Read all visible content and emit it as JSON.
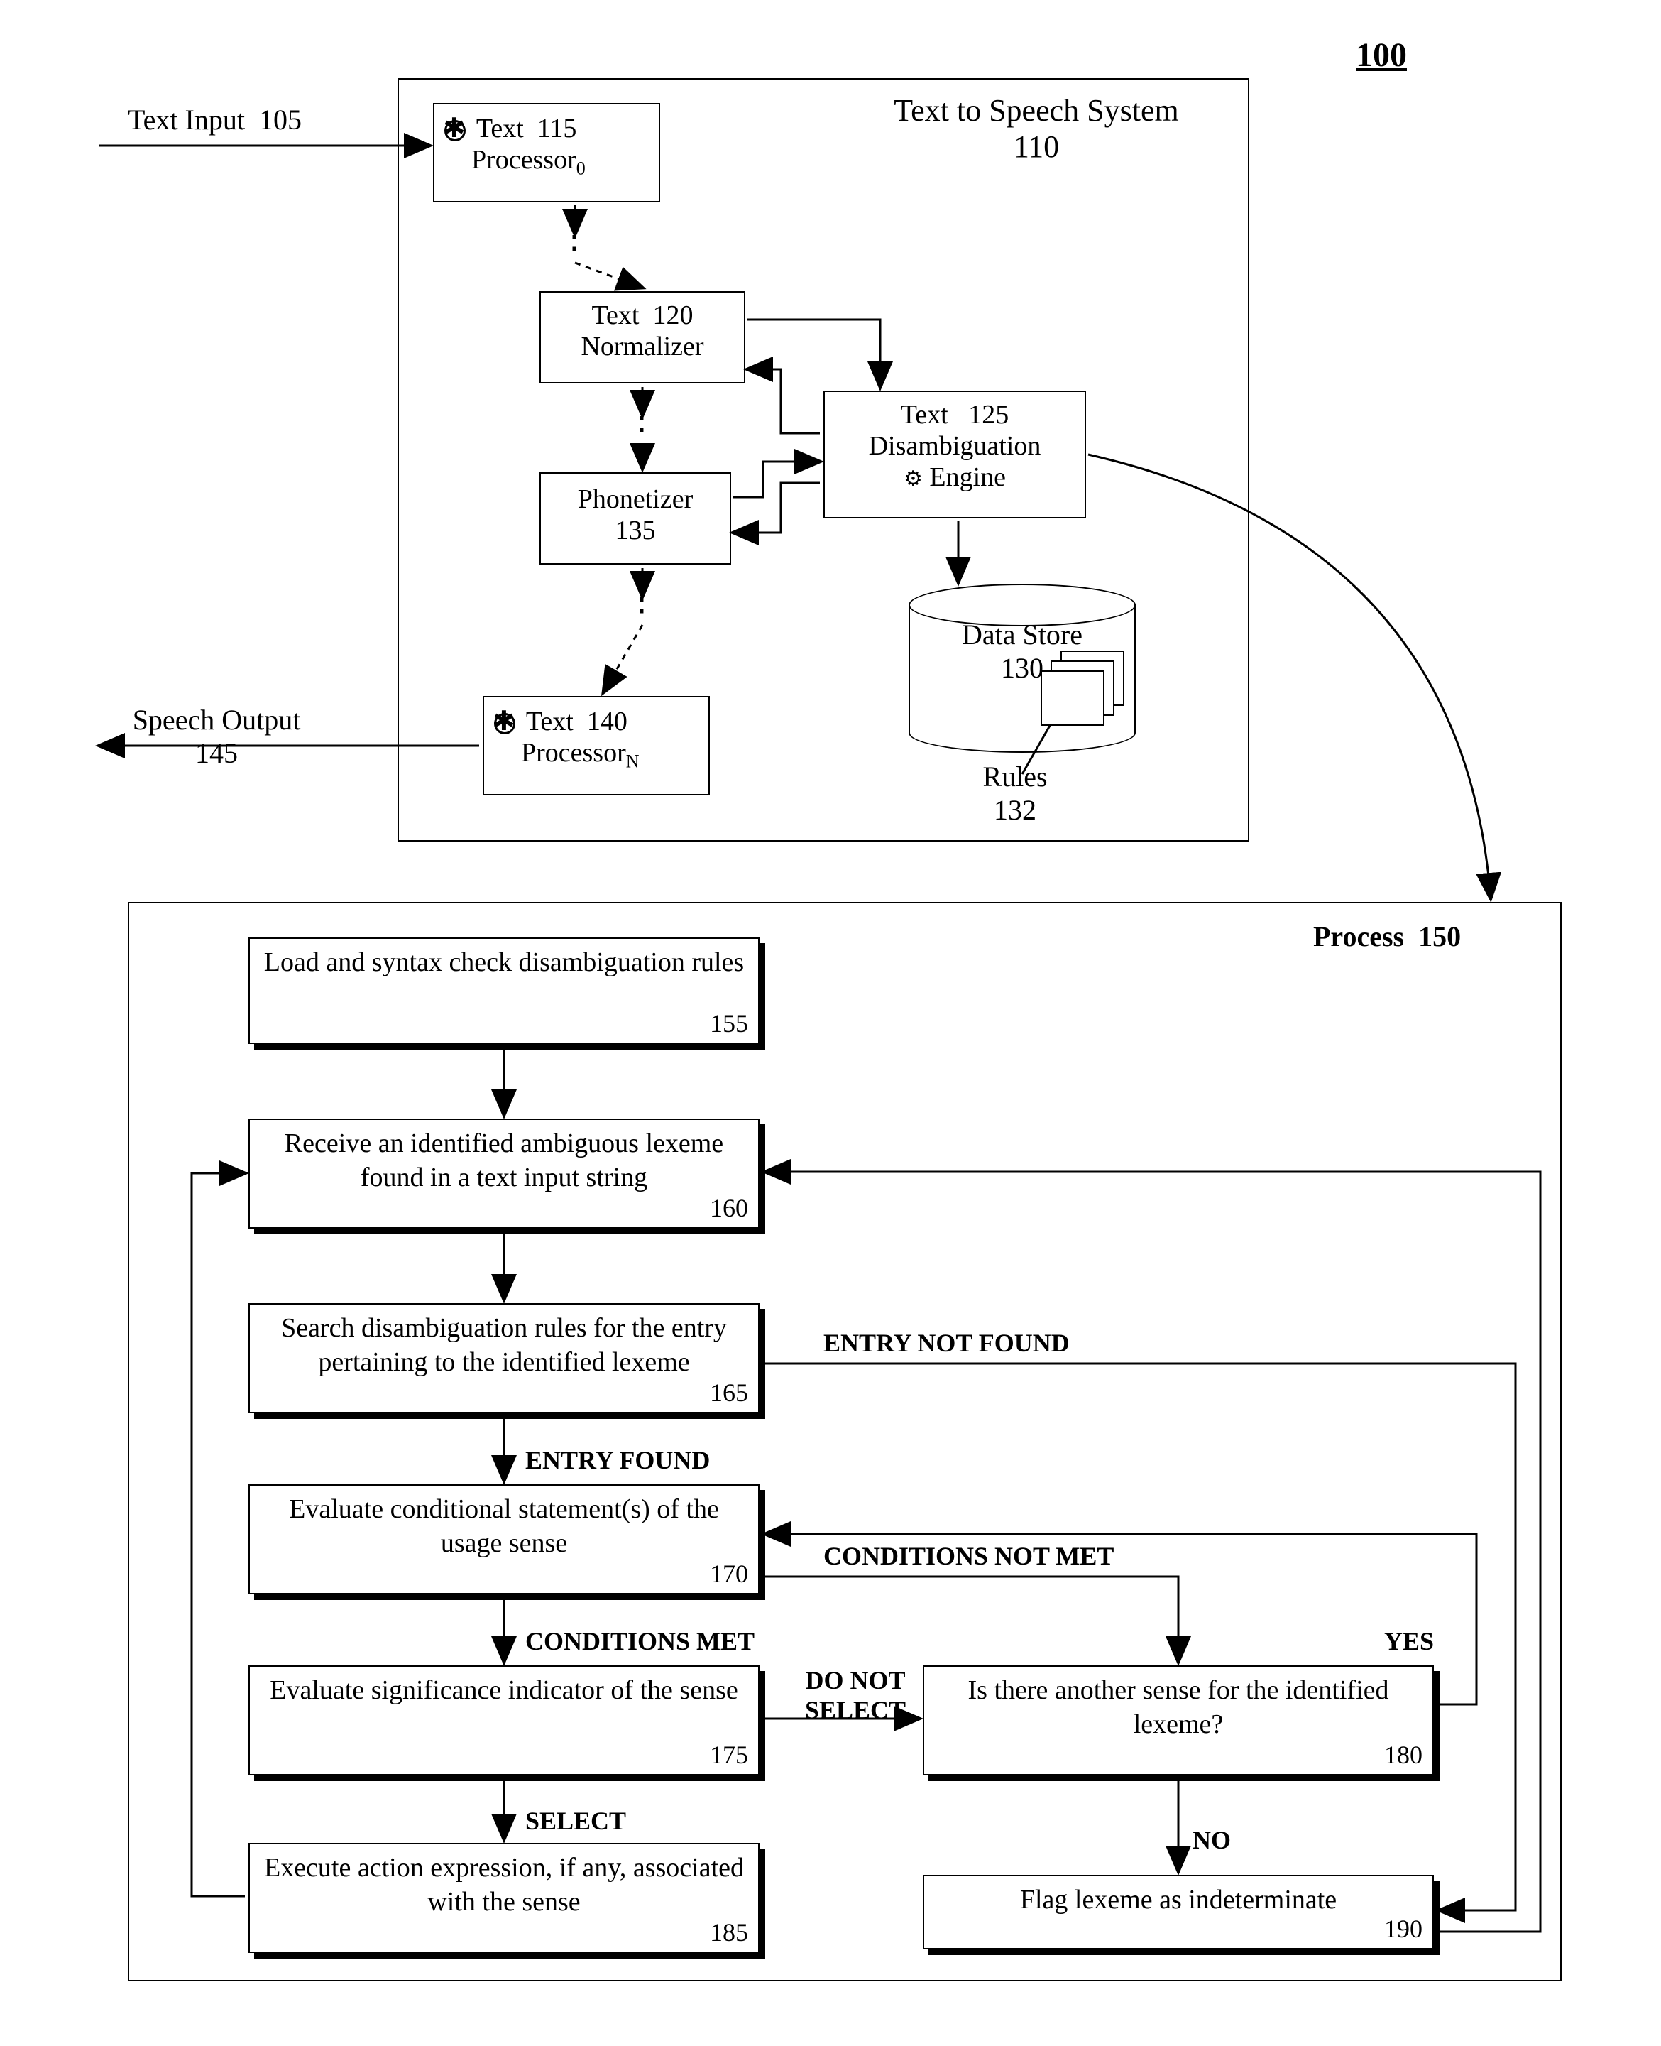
{
  "figureRef": "100",
  "upper": {
    "textInput": {
      "label": "Text Input",
      "num": "105"
    },
    "speechOutput": {
      "label": "Speech Output",
      "num": "145"
    },
    "tts": {
      "label": "Text to Speech System",
      "num": "110"
    },
    "textProcessor0": {
      "label": "Text",
      "sub": "Processor",
      "subIndex": "0",
      "num": "115"
    },
    "textNormalizer": {
      "label": "Text",
      "sub": "Normalizer",
      "num": "120"
    },
    "disambig": {
      "label": "Text",
      "sub": "Disambiguation",
      "sub2": "Engine",
      "num": "125"
    },
    "phonetizer": {
      "label": "Phonetizer",
      "num": "135"
    },
    "textProcessorN": {
      "label": "Text",
      "sub": "Processor",
      "subIndex": "N",
      "num": "140"
    },
    "dataStore": {
      "label": "Data Store",
      "num": "130"
    },
    "rules": {
      "label": "Rules",
      "num": "132"
    }
  },
  "process": {
    "title": "Process",
    "num": "150",
    "steps": {
      "s155": {
        "text": "Load and syntax check disambiguation rules",
        "num": "155"
      },
      "s160": {
        "text": "Receive an identified ambiguous lexeme found in a text input string",
        "num": "160"
      },
      "s165": {
        "text": "Search disambiguation rules for the entry pertaining to the identified lexeme",
        "num": "165"
      },
      "s170": {
        "text": "Evaluate conditional statement(s) of the usage sense",
        "num": "170"
      },
      "s175": {
        "text": "Evaluate significance indicator of the sense",
        "num": "175"
      },
      "s180": {
        "text": "Is there another sense for the identified lexeme?",
        "num": "180"
      },
      "s185": {
        "text": "Execute action expression, if any, associated with the sense",
        "num": "185"
      },
      "s190": {
        "text": "Flag lexeme as indeterminate",
        "num": "190"
      }
    },
    "labels": {
      "entryFound": "ENTRY FOUND",
      "entryNotFound": "ENTRY NOT FOUND",
      "condMet": "CONDITIONS MET",
      "condNotMet": "CONDITIONS NOT MET",
      "select": "SELECT",
      "doNotSelect": "DO NOT SELECT",
      "yes": "YES",
      "no": "NO"
    }
  }
}
